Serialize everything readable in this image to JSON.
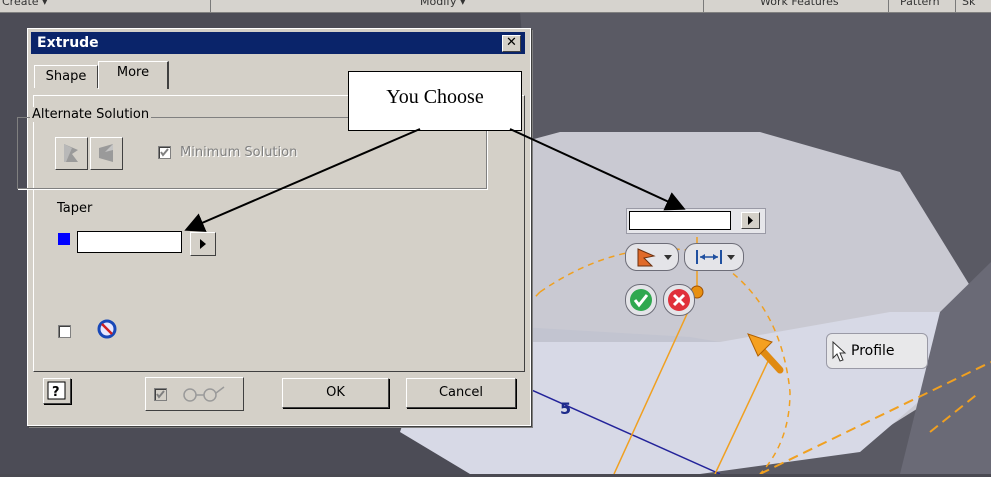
{
  "topbar": {
    "items": [
      "Create ▾",
      "Modify ▾",
      "Work Features",
      "Pattern",
      "Sk"
    ]
  },
  "dialog": {
    "title": "Extrude",
    "close_glyph": "✕",
    "tabs": [
      {
        "label": "Shape"
      },
      {
        "label": "More"
      }
    ],
    "alternate_solution": {
      "label": "Alternate Solution",
      "minimum_solution_label": "Minimum Solution",
      "minimum_solution_checked": true
    },
    "taper": {
      "label": "Taper",
      "value": ""
    },
    "buttons": {
      "ok": "OK",
      "cancel": "Cancel",
      "help": "?"
    }
  },
  "callout": {
    "text": "You Choose"
  },
  "minitoolbar": {
    "value": ""
  },
  "viewport": {
    "dimension_label": "5",
    "profile_label": "Profile"
  },
  "colors": {
    "title_bar": "#0a246a",
    "dialog_bg": "#d4d0c8",
    "taper_swatch": "#0000ff",
    "sketch_orange": "#f0a020",
    "ok_green": "#2fa84f",
    "cancel_red": "#e0303a"
  },
  "icons": [
    "close-icon",
    "flip-direction-icon",
    "minimum-solution-icon",
    "taper-color-icon",
    "infer-icon",
    "help-icon",
    "glasses-preview-icon",
    "direction-dropdown-icon",
    "distance-dropdown-icon",
    "check-icon",
    "cancel-x-icon",
    "cursor-icon"
  ]
}
